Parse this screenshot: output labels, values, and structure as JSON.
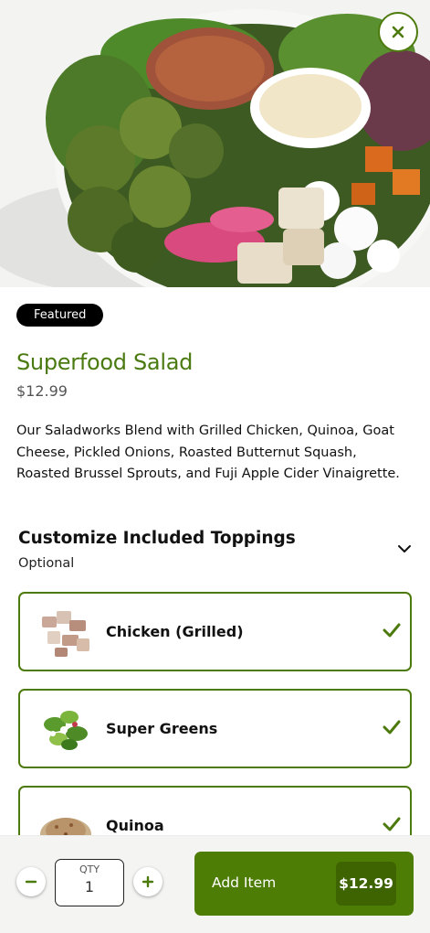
{
  "item": {
    "badge": "Featured",
    "title": "Superfood Salad",
    "price": "$12.99",
    "description": "Our Saladworks Blend with Grilled Chicken, Quinoa, Goat Cheese, Pickled Onions, Roasted Butternut Squash, Roasted Brussel Sprouts, and Fuji Apple Cider Vinaigrette."
  },
  "customize": {
    "title": "Customize Included Toppings",
    "subtitle": "Optional",
    "toppings": [
      {
        "name": "Chicken (Grilled)",
        "selected": true
      },
      {
        "name": "Super Greens",
        "selected": true
      },
      {
        "name": "Quinoa",
        "selected": true
      }
    ]
  },
  "footer": {
    "qty_label": "QTY",
    "qty_value": "1",
    "add_label": "Add Item",
    "add_price": "$12.99"
  },
  "colors": {
    "brand_green": "#4e7d05",
    "title_green": "#4a7a10",
    "button_price_bg": "#3e6402"
  },
  "icons": {
    "close": "close-icon",
    "chevron": "chevron-down-icon",
    "check": "check-icon",
    "minus": "minus-icon",
    "plus": "plus-icon"
  }
}
